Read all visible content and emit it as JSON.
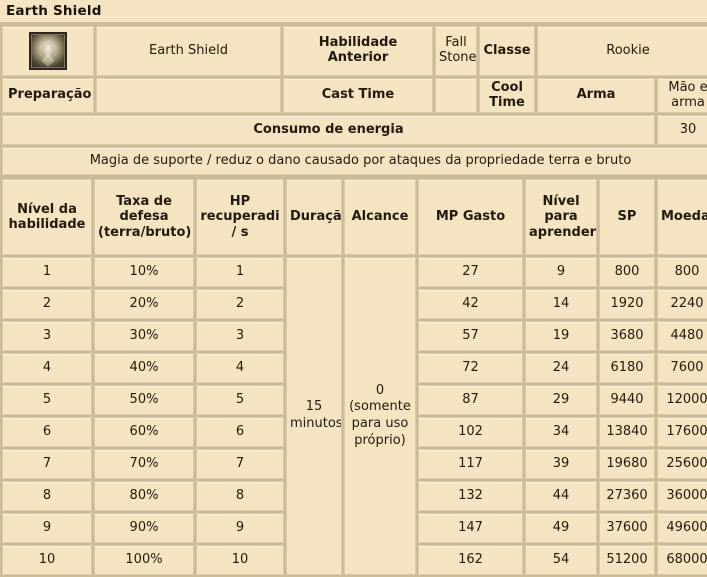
{
  "window": {
    "title": "Earth Shield"
  },
  "info": {
    "icon_name": "skill-icon-earth-shield",
    "skill_name": "Earth Shield",
    "prev_skill_label": "Habilidade Anterior",
    "prev_skill_value": "Fall Stone",
    "class_label": "Classe",
    "class_value": "Rookie",
    "prep_label": "Preparação",
    "prep_value": "",
    "cast_time_label": "Cast Time",
    "cast_time_value": "",
    "cool_time_label": "Cool Time",
    "cool_time_value": "",
    "weapon_label": "Arma",
    "weapon_value": "Mão e arma",
    "energy_label": "Consumo de energia",
    "energy_value": "30",
    "description": "Magia de suporte / reduz o dano causado por ataques da propriedade terra e bruto"
  },
  "table": {
    "headers": [
      "Nível da habilidade",
      "Taxa de defesa (terra/bruto)",
      "HP recuperadi / s",
      "Duração",
      "Alcance",
      "MP Gasto",
      "Nível para aprender",
      "SP",
      "Moedas"
    ],
    "merged": {
      "duracao": "15 minutos",
      "alcance": "0 (somente para uso próprio)"
    },
    "rows": [
      {
        "nivel": "1",
        "defesa": "10%",
        "hp": "1",
        "mp": "27",
        "aprender": "9",
        "sp": "800",
        "moedas": "800"
      },
      {
        "nivel": "2",
        "defesa": "20%",
        "hp": "2",
        "mp": "42",
        "aprender": "14",
        "sp": "1920",
        "moedas": "2240"
      },
      {
        "nivel": "3",
        "defesa": "30%",
        "hp": "3",
        "mp": "57",
        "aprender": "19",
        "sp": "3680",
        "moedas": "4480"
      },
      {
        "nivel": "4",
        "defesa": "40%",
        "hp": "4",
        "mp": "72",
        "aprender": "24",
        "sp": "6180",
        "moedas": "7600"
      },
      {
        "nivel": "5",
        "defesa": "50%",
        "hp": "5",
        "mp": "87",
        "aprender": "29",
        "sp": "9440",
        "moedas": "12000"
      },
      {
        "nivel": "6",
        "defesa": "60%",
        "hp": "6",
        "mp": "102",
        "aprender": "34",
        "sp": "13840",
        "moedas": "17600"
      },
      {
        "nivel": "7",
        "defesa": "70%",
        "hp": "7",
        "mp": "117",
        "aprender": "39",
        "sp": "19680",
        "moedas": "25600"
      },
      {
        "nivel": "8",
        "defesa": "80%",
        "hp": "8",
        "mp": "132",
        "aprender": "44",
        "sp": "27360",
        "moedas": "36000"
      },
      {
        "nivel": "9",
        "defesa": "90%",
        "hp": "9",
        "mp": "147",
        "aprender": "49",
        "sp": "37600",
        "moedas": "49600"
      },
      {
        "nivel": "10",
        "defesa": "100%",
        "hp": "10",
        "mp": "162",
        "aprender": "54",
        "sp": "51200",
        "moedas": "68000"
      }
    ]
  },
  "colors": {
    "page_background": "#f6e7c4",
    "cell_background": "#f4e4c1",
    "grid_line": "#cbbc97",
    "text": "#241a0c"
  }
}
